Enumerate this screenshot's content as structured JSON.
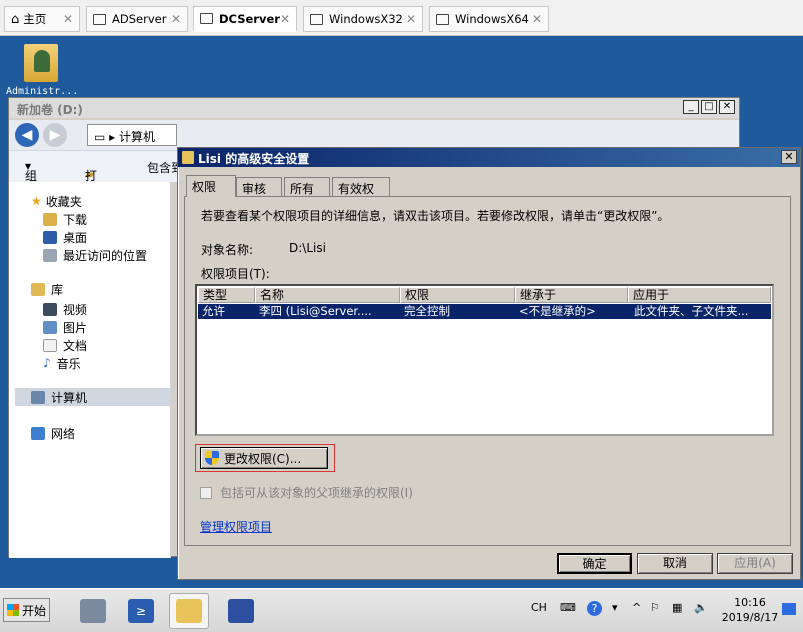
{
  "host_tabs": [
    {
      "label": "主页",
      "active": false,
      "closable": false
    },
    {
      "label": "ADServer",
      "active": false,
      "closable": true
    },
    {
      "label": "DCServer",
      "active": true,
      "closable": true
    },
    {
      "label": "WindowsX32",
      "active": false,
      "closable": true
    },
    {
      "label": "WindowsX64",
      "active": false,
      "closable": true
    }
  ],
  "desktop": {
    "icon_label": "Administr..."
  },
  "explorer": {
    "title": "新加卷 (D:)",
    "address": "计算机",
    "toolbar": {
      "organize": "组织",
      "open": "打开",
      "include": "包含到"
    },
    "nav": {
      "favorites": "收藏夹",
      "downloads": "下载",
      "desktop": "桌面",
      "recent": "最近访问的位置",
      "libraries": "库",
      "videos": "视频",
      "pictures": "图片",
      "documents": "文档",
      "music": "音乐",
      "computer": "计算机",
      "network": "网络"
    }
  },
  "dialog": {
    "title": "Lisi 的高级安全设置",
    "tabs": [
      "权限",
      "审核",
      "所有者",
      "有效权限"
    ],
    "instruction": "若要查看某个权限项目的详细信息，请双击该项目。若要修改权限，请单击“更改权限”。",
    "object_label": "对象名称:",
    "object_value": "D:\\Lisi",
    "entries_label": "权限项目(T):",
    "columns": [
      "类型",
      "名称",
      "权限",
      "继承于",
      "应用于"
    ],
    "rows": [
      {
        "type": "允许",
        "name": "李四 (Lisi@Server....",
        "permission": "完全控制",
        "inherited": "<不是继承的>",
        "applies_to": "此文件夹、子文件夹..."
      }
    ],
    "change_button": "更改权限(C)...",
    "inherit_checkbox": "包括可从该对象的父项继承的权限(I)",
    "manage_link": "管理权限项目",
    "ok": "确定",
    "cancel": "取消",
    "apply": "应用(A)"
  },
  "taskbar": {
    "start": "开始",
    "lang": "CH",
    "time": "10:16",
    "date": "2019/8/17"
  }
}
